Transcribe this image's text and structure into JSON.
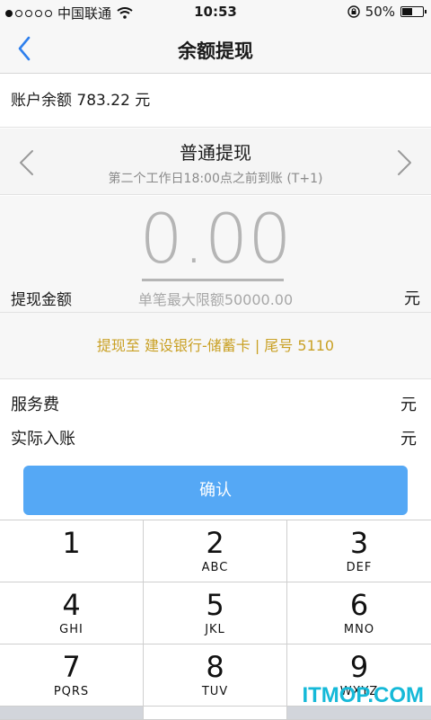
{
  "status_bar": {
    "carrier": "中国联通",
    "time": "10:53",
    "battery_percent": "50%",
    "battery_level": 0.5,
    "signal_bars_filled": 1,
    "signal_bars_total": 5
  },
  "nav": {
    "title": "余额提现",
    "back_icon": "chevron-left-icon"
  },
  "balance": {
    "text": "账户余额 783.22 元"
  },
  "withdraw_type": {
    "title": "普通提现",
    "subtitle": "第二个工作日18:00点之前到账 (T+1)"
  },
  "amount": {
    "value": "0.00",
    "label": "提现金额",
    "limit_text": "单笔最大限额50000.00",
    "unit": "元"
  },
  "destination": {
    "text": "提现至 建设银行-储蓄卡 | 尾号 5110",
    "color": "#c9a024"
  },
  "fees": {
    "service_fee_label": "服务费",
    "service_fee_unit": "元",
    "actual_label": "实际入账",
    "actual_unit": "元"
  },
  "confirm": {
    "label": "确认",
    "color": "#55a8f5"
  },
  "keypad": {
    "keys": [
      {
        "num": "1",
        "letters": ""
      },
      {
        "num": "2",
        "letters": "ABC"
      },
      {
        "num": "3",
        "letters": "DEF"
      },
      {
        "num": "4",
        "letters": "GHI"
      },
      {
        "num": "5",
        "letters": "JKL"
      },
      {
        "num": "6",
        "letters": "MNO"
      },
      {
        "num": "7",
        "letters": "PQRS"
      },
      {
        "num": "8",
        "letters": "TUV"
      },
      {
        "num": "9",
        "letters": "WXYZ"
      }
    ]
  },
  "watermark": "ITMOP.COM"
}
